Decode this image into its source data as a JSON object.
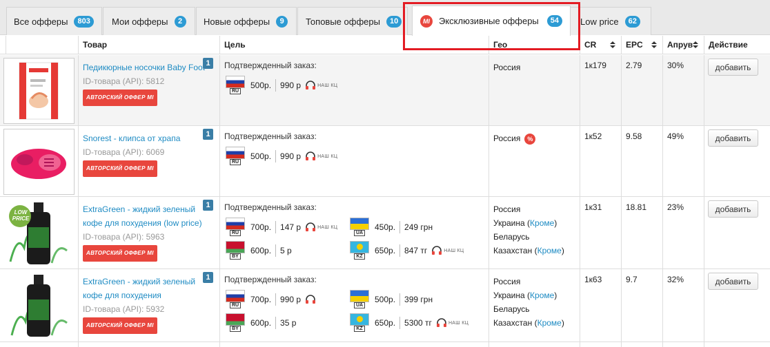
{
  "tabs": [
    {
      "label": "Все офферы",
      "count": "803"
    },
    {
      "label": "Мои офферы",
      "count": "2"
    },
    {
      "label": "Новые офферы",
      "count": "9"
    },
    {
      "label": "Топовые офферы",
      "count": "10"
    },
    {
      "label": "Эксклюзивные офферы",
      "count": "54",
      "logo": "MI"
    },
    {
      "label": "Low price",
      "count": "62"
    }
  ],
  "columns": {
    "product": "Товар",
    "goal": "Цель",
    "geo": "Гео",
    "cr": "CR",
    "epc": "EPC",
    "approve": "Апрув",
    "action": "Действие"
  },
  "author_badge": "АВТОРСКИЙ ОФФЕР MI",
  "add_label": "добавить",
  "call_center_label": "НАШ КЦ",
  "rows": [
    {
      "name": "Педикюрные носочки Baby Foot",
      "id_text": "ID-товара (API): 5812",
      "num": "1",
      "goal_label": "Подтвержденный заказ:",
      "payouts": [
        {
          "country_code": "RU",
          "amount": "500р.",
          "price": "990 р"
        }
      ],
      "geo": [
        {
          "country": "Россия"
        }
      ],
      "cr": "1к179",
      "epc": "2.79",
      "approve": "30%"
    },
    {
      "name": "Snorest - клипса от храпа",
      "id_text": "ID-товара (API): 6069",
      "num": "1",
      "goal_label": "Подтвержденный заказ:",
      "payouts": [
        {
          "country_code": "RU",
          "amount": "500р.",
          "price": "990 р"
        }
      ],
      "geo": [
        {
          "country": "Россия",
          "percent_badge": "%"
        }
      ],
      "cr": "1к52",
      "epc": "9.58",
      "approve": "49%"
    },
    {
      "name": "ExtraGreen - жидкий зеленый кофе для похудения (low price)",
      "id_text": "ID-товара (API): 5963",
      "num": "1",
      "goal_label": "Подтвержденный заказ:",
      "payouts": [
        {
          "country_code": "RU",
          "amount": "700р.",
          "price": "147 р"
        },
        {
          "country_code": "UA",
          "amount": "450р.",
          "price": "249 грн"
        },
        {
          "country_code": "BY",
          "amount": "600р.",
          "price": "5 р"
        },
        {
          "country_code": "KZ",
          "amount": "650р.",
          "price": "847 тг"
        }
      ],
      "geo": [
        {
          "country": "Россия"
        },
        {
          "country": "Украина",
          "except": "Кроме"
        },
        {
          "country": "Беларусь"
        },
        {
          "country": "Казахстан",
          "except": "Кроме"
        }
      ],
      "cr": "1к31",
      "epc": "18.81",
      "approve": "23%",
      "low_price_badge": "LOW PRICE"
    },
    {
      "name": "ExtraGreen - жидкий зеленый кофе для похудения",
      "id_text": "ID-товара (API): 5932",
      "num": "1",
      "goal_label": "Подтвержденный заказ:",
      "payouts": [
        {
          "country_code": "RU",
          "amount": "700р.",
          "price": "990 р"
        },
        {
          "country_code": "UA",
          "amount": "500р.",
          "price": "399 грн"
        },
        {
          "country_code": "BY",
          "amount": "600р.",
          "price": "35 р"
        },
        {
          "country_code": "KZ",
          "amount": "650р.",
          "price": "5300 тг"
        }
      ],
      "geo": [
        {
          "country": "Россия"
        },
        {
          "country": "Украина",
          "except": "Кроме"
        },
        {
          "country": "Беларусь"
        },
        {
          "country": "Казахстан",
          "except": "Кроме"
        }
      ],
      "cr": "1к63",
      "epc": "9.7",
      "approve": "32%"
    }
  ],
  "colors": {
    "accent": "#2d9bd4",
    "link": "#1e8bc3",
    "brand_red": "#e8463d",
    "highlight": "#e31b23"
  }
}
